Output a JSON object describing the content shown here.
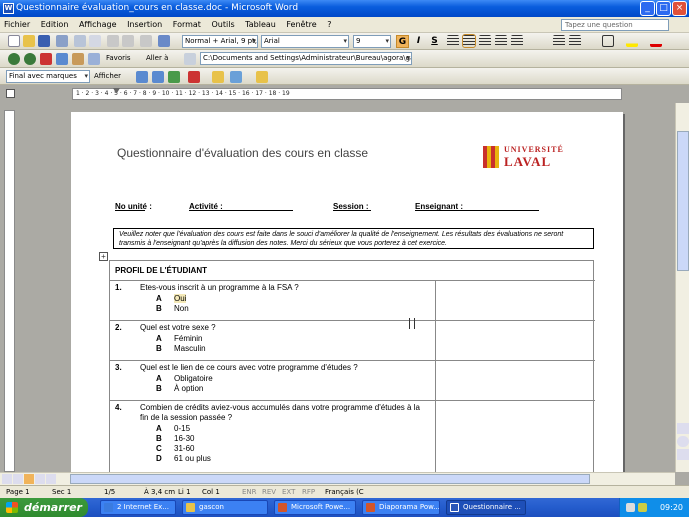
{
  "window": {
    "title": "Questionnaire évaluation_cours en classe.doc - Microsoft Word",
    "app_icon": "W",
    "controls": {
      "minimize": "_",
      "maximize": "□",
      "close": "×"
    }
  },
  "menubar": {
    "items": [
      "Fichier",
      "Edition",
      "Affichage",
      "Insertion",
      "Format",
      "Outils",
      "Tableau",
      "Fenêtre",
      "?"
    ],
    "help_placeholder": "Tapez une question"
  },
  "formatting_toolbar": {
    "style": "Normal + Arial, 9 pt,",
    "font": "Arial",
    "size": "9",
    "bold": "G",
    "italic": "I",
    "underline": "S"
  },
  "web_toolbar": {
    "favoris": "Favoris",
    "aller": "Aller à",
    "address": "C:\\Documents and Settings\\Administrateur\\Bureau\\agora\\gas"
  },
  "review_toolbar": {
    "mode": "Final avec marques",
    "show": "Afficher"
  },
  "ruler": {
    "labels": "1 · 2 · 3 · 4 · 5 · 6 · 7 · 8 · 9 · 10 · 11 · 12 · 13 · 14 · 15 · 16 · 17 · 18 · 19"
  },
  "document": {
    "title": "Questionnaire d'évaluation des cours en classe",
    "logo": {
      "line1": "UNIVERSITÉ",
      "line2": "LAVAL"
    },
    "fields": {
      "unit": "No unité :",
      "activity": "Activité :",
      "session": "Session :",
      "teacher": "Enseignant :"
    },
    "note": "Veuillez noter que l'évaluation des cours est faite dans le souci d'améliorer la qualité de l'enseignement. Les résultats des évaluations ne seront transmis à l'enseignant qu'après la diffusion des notes. Merci du sérieux que vous porterez à cet exercice.",
    "section_header": "PROFIL DE L'ÉTUDIANT",
    "questions": [
      {
        "num": "1.",
        "text": "Etes-vous inscrit à un programme à la FSA ?",
        "options": [
          {
            "letter": "A",
            "label": "Oui"
          },
          {
            "letter": "B",
            "label": "Non"
          }
        ]
      },
      {
        "num": "2.",
        "text": "Quel est votre sexe ?",
        "options": [
          {
            "letter": "A",
            "label": "Féminin"
          },
          {
            "letter": "B",
            "label": "Masculin"
          }
        ]
      },
      {
        "num": "3.",
        "text": "Quel est le lien de ce cours avec votre programme d'études ?",
        "options": [
          {
            "letter": "A",
            "label": "Obligatoire"
          },
          {
            "letter": "B",
            "label": "À option"
          }
        ]
      },
      {
        "num": "4.",
        "text": "Combien de crédits aviez-vous accumulés dans votre programme d'études à la fin de la session passée ?",
        "options": [
          {
            "letter": "A",
            "label": "0-15"
          },
          {
            "letter": "B",
            "label": "16-30"
          },
          {
            "letter": "C",
            "label": "31-60"
          },
          {
            "letter": "D",
            "label": "61 ou plus"
          }
        ]
      }
    ]
  },
  "statusbar": {
    "page": "Page 1",
    "section": "Sec 1",
    "pages": "1/5",
    "position": "À 3,4 cm",
    "line": "Li 1",
    "column": "Col 1",
    "enr": "ENR",
    "rev": "REV",
    "ext": "EXT",
    "rfp": "RFP",
    "language": "Français (C"
  },
  "taskbar": {
    "start": "démarrer",
    "tasks": [
      {
        "label": "2 Internet Ex...",
        "color": "#3a7be0"
      },
      {
        "label": "gascon",
        "color": "#e8c34a"
      },
      {
        "label": "Microsoft Powe...",
        "color": "#d2552a"
      },
      {
        "label": "Diaporama Pow...",
        "color": "#d2552a"
      },
      {
        "label": "Questionnaire ...",
        "color": "#2b57b8"
      }
    ],
    "clock": "09:20"
  }
}
